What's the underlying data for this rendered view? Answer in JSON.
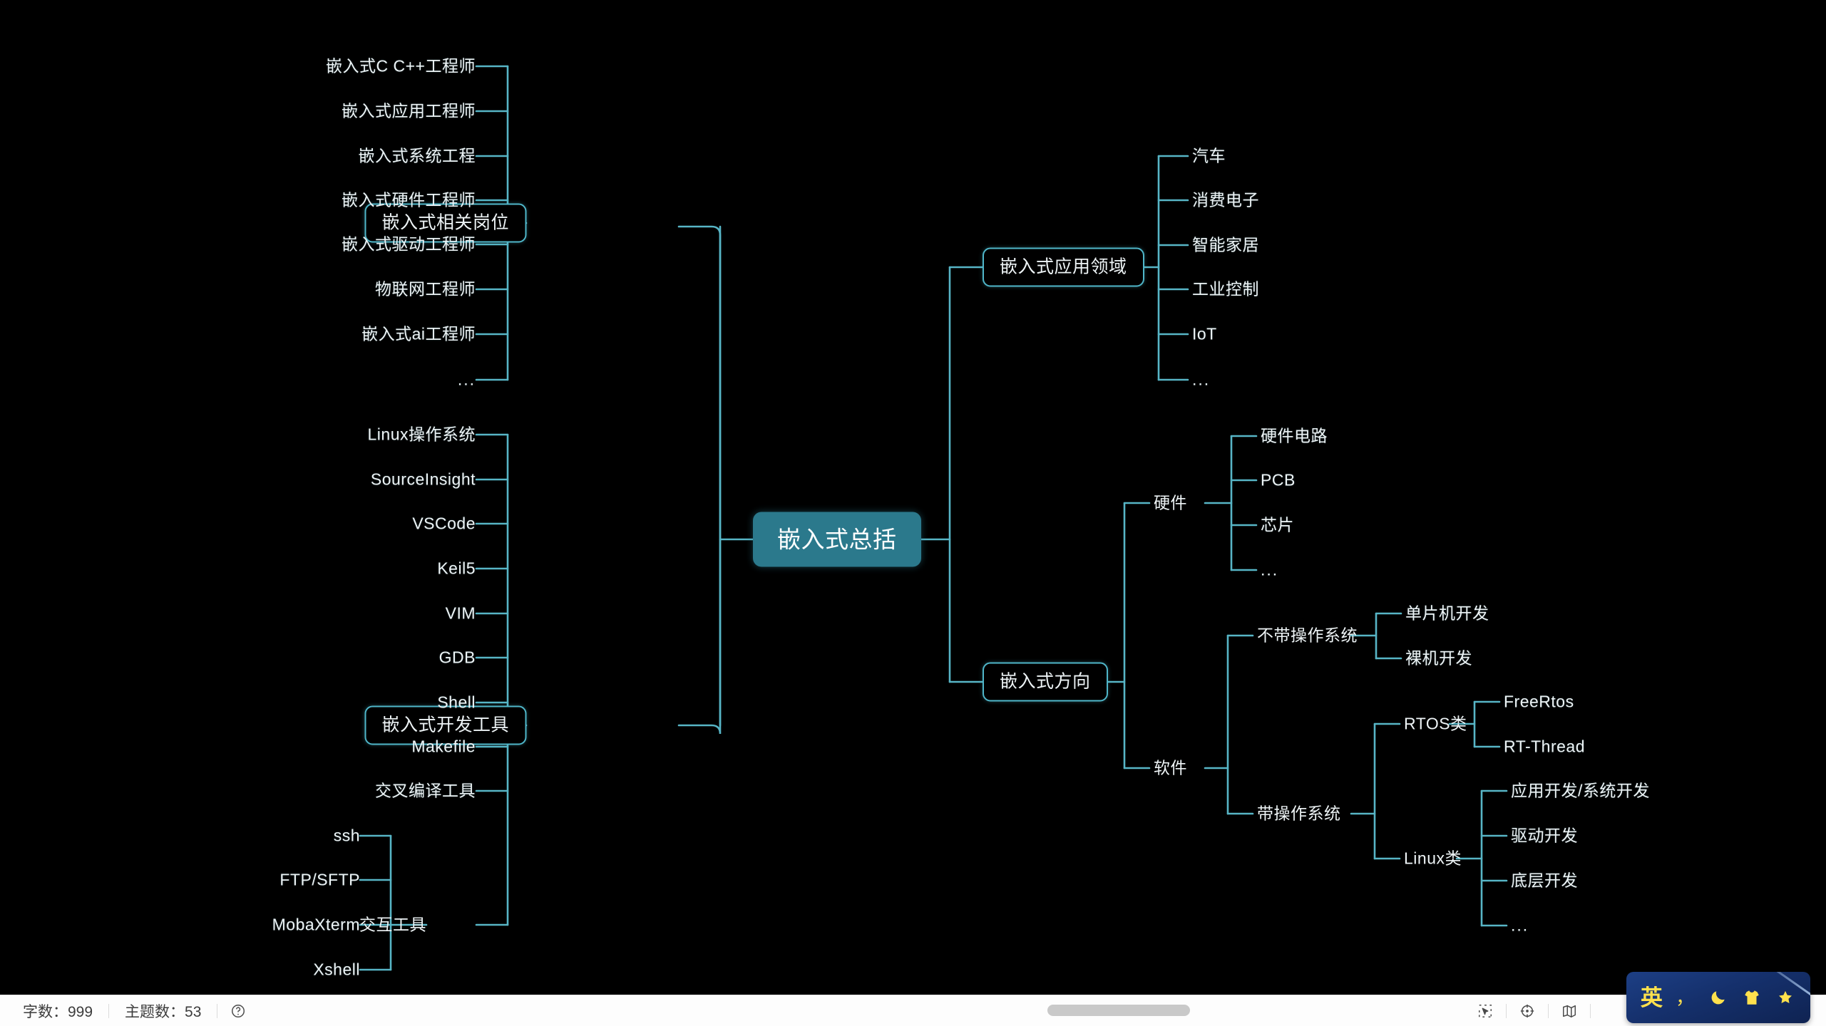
{
  "app": {
    "background_color": "#000000",
    "link_color": "#57b5c6",
    "node_border_color": "#4fb6c9",
    "root_fill_color": "#2b798c",
    "text_color": "#eef4f6"
  },
  "mindmap": {
    "root": "嵌入式总括",
    "left_branches": [
      {
        "label": "嵌入式相关岗位",
        "children": [
          {
            "label": "嵌入式C C++工程师"
          },
          {
            "label": "嵌入式应用工程师"
          },
          {
            "label": "嵌入式系统工程"
          },
          {
            "label": "嵌入式硬件工程师"
          },
          {
            "label": "嵌入式驱动工程师"
          },
          {
            "label": "物联网工程师"
          },
          {
            "label": "嵌入式ai工程师"
          },
          {
            "label": "..."
          }
        ]
      },
      {
        "label": "嵌入式开发工具",
        "children": [
          {
            "label": "Linux操作系统"
          },
          {
            "label": "SourceInsight"
          },
          {
            "label": "VSCode"
          },
          {
            "label": "Keil5"
          },
          {
            "label": "VIM"
          },
          {
            "label": "GDB"
          },
          {
            "label": "Shell"
          },
          {
            "label": "Makefile"
          },
          {
            "label": "交叉编译工具"
          },
          {
            "label": "交互工具",
            "children": [
              {
                "label": "ssh"
              },
              {
                "label": "FTP/SFTP"
              },
              {
                "label": "MobaXterm"
              },
              {
                "label": "Xshell"
              }
            ]
          }
        ]
      }
    ],
    "right_branches": [
      {
        "label": "嵌入式应用领域",
        "children": [
          {
            "label": "汽车"
          },
          {
            "label": "消费电子"
          },
          {
            "label": "智能家居"
          },
          {
            "label": "工业控制"
          },
          {
            "label": "IoT"
          },
          {
            "label": "..."
          }
        ]
      },
      {
        "label": "嵌入式方向",
        "children": [
          {
            "label": "硬件",
            "children": [
              {
                "label": "硬件电路"
              },
              {
                "label": "PCB"
              },
              {
                "label": "芯片"
              },
              {
                "label": "..."
              }
            ]
          },
          {
            "label": "软件",
            "children": [
              {
                "label": "不带操作系统",
                "children": [
                  {
                    "label": "单片机开发"
                  },
                  {
                    "label": "裸机开发"
                  }
                ]
              },
              {
                "label": "带操作系统",
                "children": [
                  {
                    "label": "RTOS类",
                    "children": [
                      {
                        "label": "FreeRtos"
                      },
                      {
                        "label": "RT-Thread"
                      }
                    ]
                  },
                  {
                    "label": "Linux类",
                    "children": [
                      {
                        "label": "应用开发/系统开发"
                      },
                      {
                        "label": "驱动开发"
                      },
                      {
                        "label": "底层开发"
                      },
                      {
                        "label": "..."
                      }
                    ]
                  }
                ]
              }
            ]
          }
        ]
      }
    ]
  },
  "statusbar": {
    "word_count_label": "字数：",
    "word_count_value": "999",
    "topic_count_label": "主题数：",
    "topic_count_value": "53",
    "help_icon": "help-circle-icon",
    "select_icon": "selection-cursor-icon",
    "center_icon": "center-target-icon",
    "outline_icon": "outline-map-icon"
  },
  "ime": {
    "language": "英",
    "punctuation": "，",
    "moon_icon": "moon-icon",
    "skin_icon": "shirt-icon",
    "star_icon": "star-icon"
  }
}
